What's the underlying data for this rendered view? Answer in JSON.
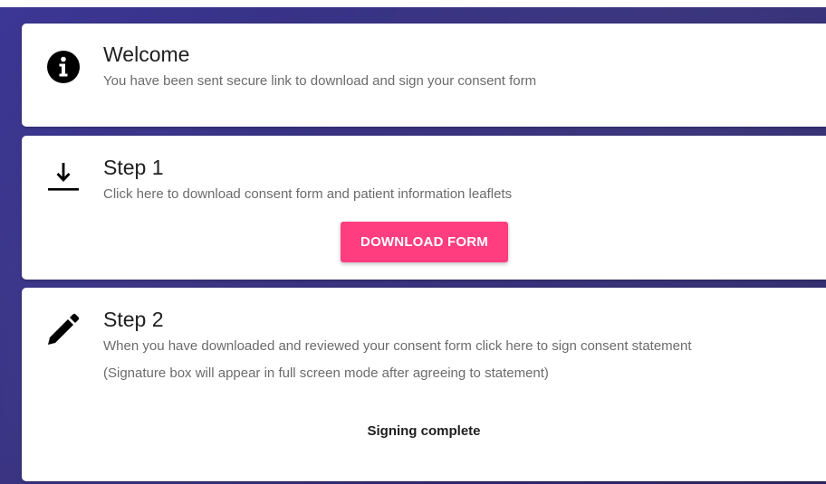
{
  "welcome": {
    "icon": "info-icon",
    "title": "Welcome",
    "description": "You have been sent secure link to download and sign your consent form"
  },
  "step1": {
    "icon": "download-icon",
    "title": "Step 1",
    "description": "Click here to download consent form and patient information leaflets",
    "button_label": "DOWNLOAD FORM"
  },
  "step2": {
    "icon": "pencil-icon",
    "title": "Step 2",
    "description_line1": "When you have downloaded and reviewed your consent form click here to sign consent statement",
    "description_line2": "(Signature box will appear in full screen mode after agreeing to statement)",
    "status": "Signing complete"
  },
  "colors": {
    "background": "#35307e",
    "button": "#ff3d7f",
    "card": "#ffffff"
  }
}
